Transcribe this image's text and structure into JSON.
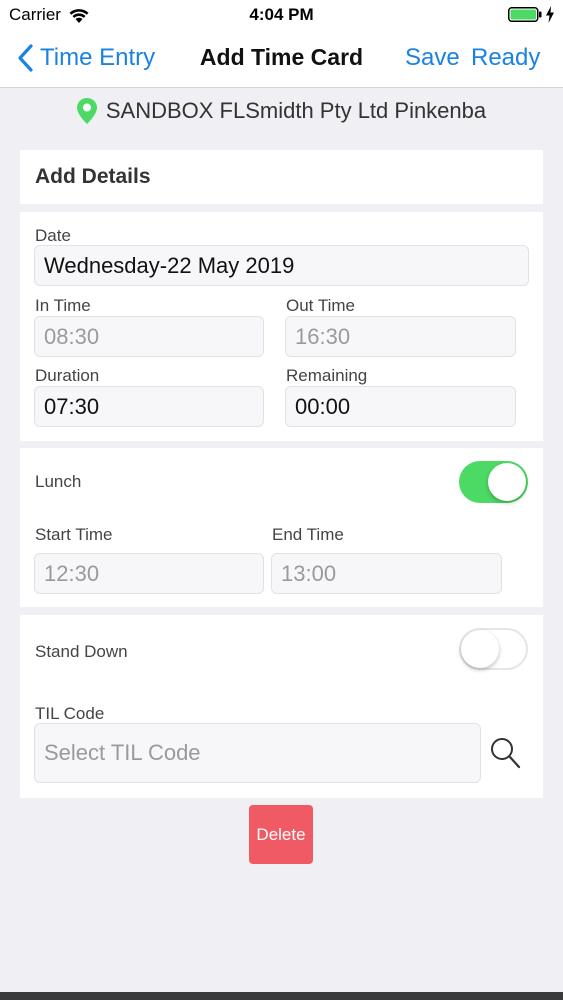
{
  "status_bar": {
    "carrier": "Carrier",
    "time": "4:04 PM"
  },
  "nav": {
    "back_label": "Time Entry",
    "title": "Add Time Card",
    "save_label": "Save",
    "ready_label": "Ready"
  },
  "location": {
    "name": "SANDBOX FLSmidth Pty Ltd Pinkenba",
    "icon": "map-pin-icon",
    "color": "#4cd964"
  },
  "details_header": "Add Details",
  "date": {
    "label": "Date",
    "value": "Wednesday-22 May 2019"
  },
  "in_time": {
    "label": "In Time",
    "placeholder": "08:30"
  },
  "out_time": {
    "label": "Out Time",
    "placeholder": "16:30"
  },
  "duration": {
    "label": "Duration",
    "value": "07:30"
  },
  "remaining": {
    "label": "Remaining",
    "value": "00:00"
  },
  "lunch": {
    "label": "Lunch",
    "enabled": true,
    "start_label": "Start Time",
    "start_placeholder": "12:30",
    "end_label": "End Time",
    "end_placeholder": "13:00"
  },
  "stand_down": {
    "label": "Stand Down",
    "enabled": false
  },
  "til_code": {
    "label": "TIL Code",
    "placeholder": "Select TIL Code"
  },
  "delete_label": "Delete",
  "colors": {
    "accent": "#1a82e2",
    "toggle_on": "#4cd964",
    "delete": "#ef5a64"
  }
}
